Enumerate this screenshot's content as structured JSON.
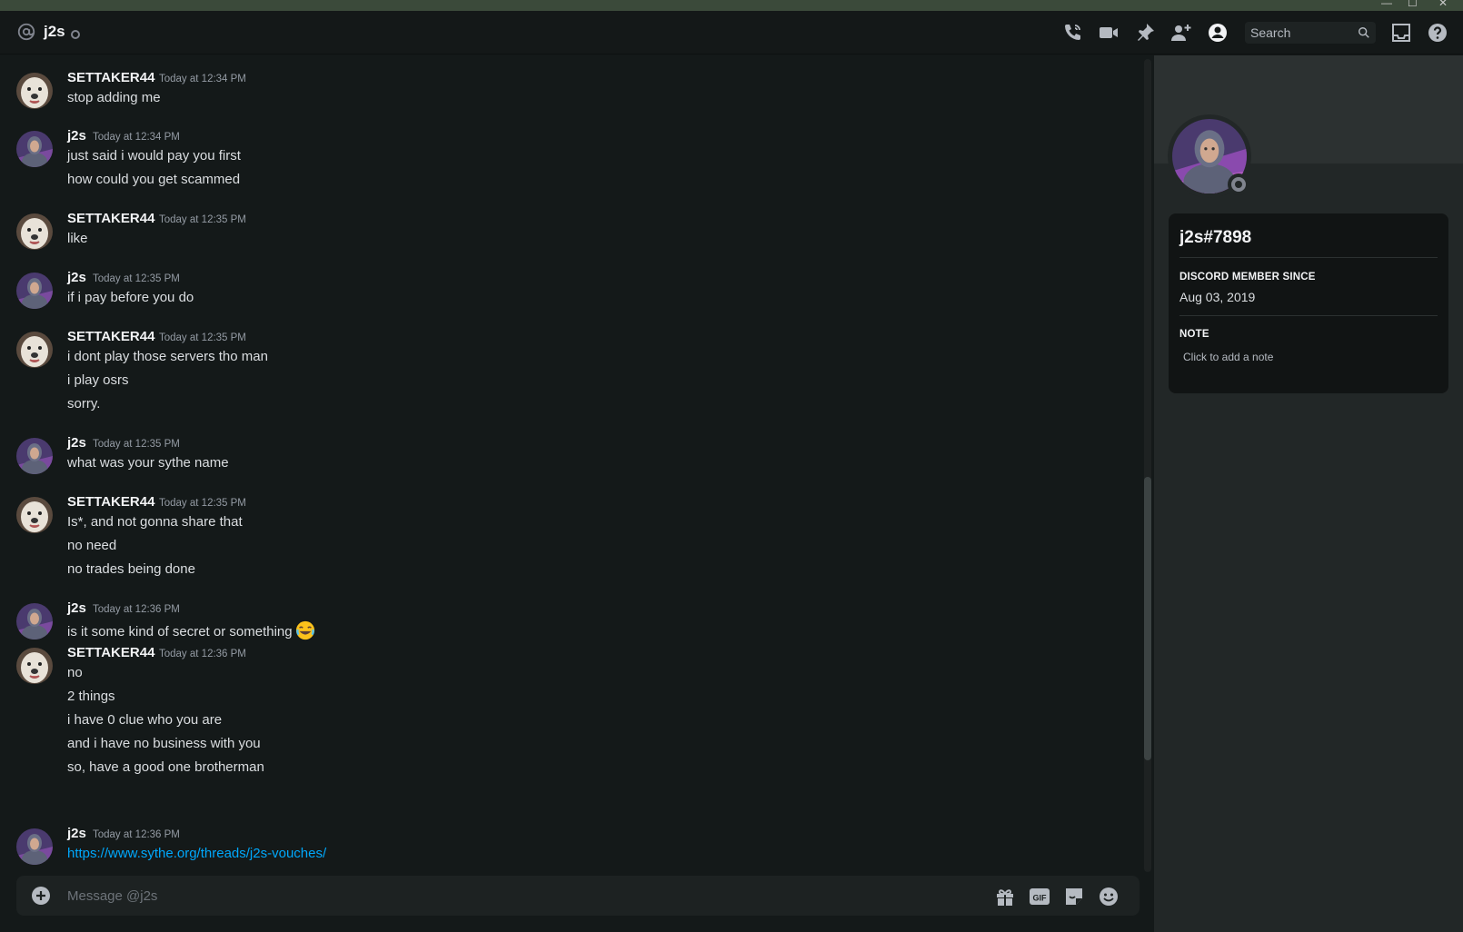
{
  "window": {
    "minimize": "—",
    "maximize": "☐",
    "close": "✕"
  },
  "header": {
    "channel_name": "j2s",
    "search_placeholder": "Search"
  },
  "messages": [
    {
      "author": "SETTAKER44",
      "avatar": "dog",
      "timestamp": "Today at 12:34 PM",
      "lines": [
        "stop adding me"
      ]
    },
    {
      "author": "j2s",
      "avatar": "person",
      "timestamp": "Today at 12:34 PM",
      "lines": [
        "just said i would pay you first",
        "how could you get scammed"
      ]
    },
    {
      "author": "SETTAKER44",
      "avatar": "dog",
      "timestamp": "Today at 12:35 PM",
      "lines": [
        "like"
      ]
    },
    {
      "author": "j2s",
      "avatar": "person",
      "timestamp": "Today at 12:35 PM",
      "lines": [
        "if i pay before you do"
      ]
    },
    {
      "author": "SETTAKER44",
      "avatar": "dog",
      "timestamp": "Today at 12:35 PM",
      "lines": [
        "i dont play those servers tho man",
        "i play osrs",
        "sorry."
      ]
    },
    {
      "author": "j2s",
      "avatar": "person",
      "timestamp": "Today at 12:35 PM",
      "lines": [
        "what was your sythe name"
      ]
    },
    {
      "author": "SETTAKER44",
      "avatar": "dog",
      "timestamp": "Today at 12:35 PM",
      "lines": [
        "Is*, and not gonna share that",
        "no need",
        "no trades being done"
      ]
    },
    {
      "author": "j2s",
      "avatar": "person",
      "timestamp": "Today at 12:36 PM",
      "lines": [
        "is it some kind of secret or something"
      ],
      "emoji": "joy-emoji"
    },
    {
      "author": "SETTAKER44",
      "avatar": "dog",
      "timestamp": "Today at 12:36 PM",
      "lines": [
        "no",
        "2 things",
        "i have 0 clue who you are",
        "and i have no business with you",
        "so, have a good one brotherman"
      ]
    },
    {
      "author": "j2s",
      "avatar": "person",
      "timestamp": "Today at 12:36 PM",
      "link": "https://www.sythe.org/threads/j2s-vouches/"
    }
  ],
  "composer": {
    "placeholder": "Message @j2s",
    "gif_label": "GIF"
  },
  "profile": {
    "handle": "j2s#7898",
    "member_since_label": "DISCORD MEMBER SINCE",
    "member_since": "Aug 03, 2019",
    "note_label": "NOTE",
    "note_placeholder": "Click to add a note"
  },
  "colors": {
    "accent_link": "#00a8fc",
    "status_offline": "#80848e"
  }
}
